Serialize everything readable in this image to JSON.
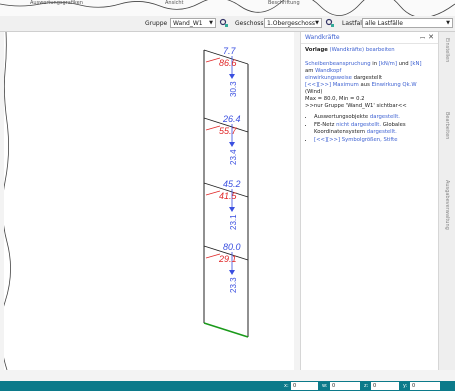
{
  "top_labels": [
    "Auswertungsgrafiken",
    "Ansicht",
    "Beschriftung"
  ],
  "toolbar": {
    "gruppe_label": "Gruppe",
    "gruppe_value": "Wand_W1",
    "geschoss_label": "Geschoss",
    "geschoss_value": "1.Obergeschoss",
    "lastfall_label": "Lastfall",
    "lastfall_value": "alle Lastfälle"
  },
  "wall": {
    "sections": [
      {
        "top_value": "7.7",
        "red_value": "86.6",
        "blue_value": "30.3"
      },
      {
        "top_value": "26.4",
        "red_value": "55.7",
        "blue_value": "23.4"
      },
      {
        "top_value": "45.2",
        "red_value": "41.5",
        "blue_value": "23.1"
      },
      {
        "top_value": "80.0",
        "red_value": "29.1",
        "blue_value": "23.3"
      }
    ],
    "colors": {
      "line": "#222222",
      "blue": "#3a4fe0",
      "red": "#e02828",
      "base": "#1a9a1a"
    }
  },
  "panel": {
    "title": "Wandkräfte",
    "pin": "ꟷ",
    "close": "✕",
    "vorlage": "Vorlage",
    "vorlage_link": "(Wandkräfte)",
    "bearbeiten": "bearbeiten",
    "line1_a": "Scheibenbeanspruchung",
    "line1_b": "in",
    "line1_c": "[kN/m]",
    "line1_d": "und",
    "line1_e": "[kN]",
    "line2_a": "am",
    "line2_b": "Wandkopf",
    "line3_a": "einwirkungsweise",
    "line3_b": "dargestellt",
    "line4_a": "[<<][>>]",
    "line4_b": "Maximum",
    "line4_c": "aus",
    "line4_d": "Einwirkung Qk.W",
    "line5": "(Wind)",
    "line6": "Max = 80.0, Min = 0.2",
    "line7": ">>nur Gruppe 'Wand_W1' sichtbar<<",
    "bullet1_a": "Auswertungsobjekte",
    "bullet1_b": "dargestellt.",
    "bullet2_a": "FE-Netz",
    "bullet2_b": "nicht dargestellt.",
    "bullet2_c": "Globales Koordinatensystem",
    "bullet2_d": "dargestellt.",
    "bullet3_a": "[<<][>>]",
    "bullet3_b": "Symbolgrößen,",
    "bullet3_c": "Stifte"
  },
  "side_tabs": [
    "Einstellen",
    "Bearbeiten",
    "Ausgabeverwaltung"
  ],
  "status": {
    "x_label": "x:",
    "x_value": "0",
    "w_label": "w:",
    "w_value": "0",
    "z_label": "z:",
    "z_value": "0",
    "y_label": "y:",
    "y_value": "0"
  }
}
